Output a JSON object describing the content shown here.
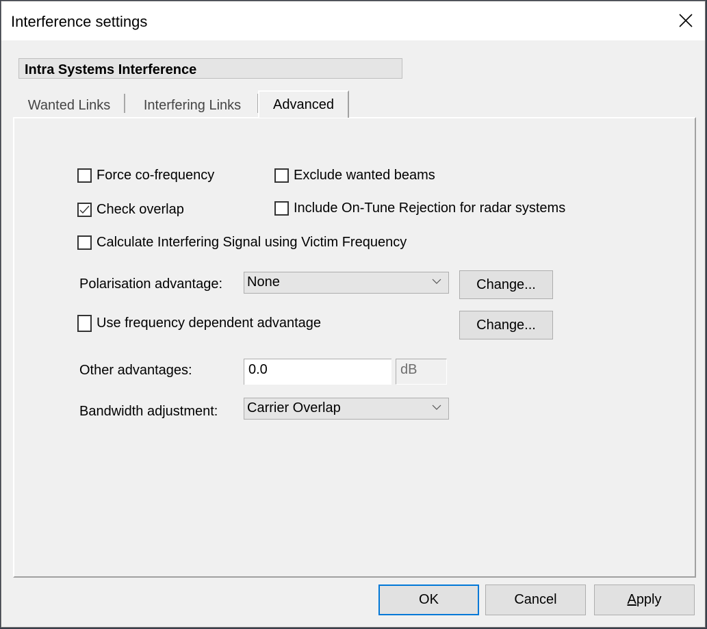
{
  "window": {
    "title": "Interference settings",
    "close_icon": "close-icon"
  },
  "group_header": "Intra Systems Interference",
  "tabs": [
    {
      "label": "Wanted Links",
      "active": false
    },
    {
      "label": "Interfering Links",
      "active": false
    },
    {
      "label": "Advanced",
      "active": true
    }
  ],
  "advanced": {
    "checkboxes": {
      "force_co_frequency": {
        "label": "Force co-frequency",
        "checked": false
      },
      "exclude_wanted_beams": {
        "label": "Exclude wanted beams",
        "checked": false
      },
      "check_overlap": {
        "label": "Check overlap",
        "checked": true
      },
      "include_on_tune_rejection": {
        "label": "Include On-Tune Rejection for radar systems",
        "checked": false
      },
      "calc_using_victim_freq": {
        "label": "Calculate Interfering Signal using Victim Frequency",
        "checked": false
      },
      "use_freq_dependent_adv": {
        "label": "Use frequency dependent advantage",
        "checked": false
      }
    },
    "polarisation": {
      "label": "Polarisation advantage:",
      "selected": "None",
      "change_label": "Change..."
    },
    "freq_dependent_change_label": "Change...",
    "other_advantages": {
      "label": "Other advantages:",
      "value": "0.0",
      "unit": "dB"
    },
    "bandwidth": {
      "label": "Bandwidth adjustment:",
      "selected": "Carrier Overlap"
    }
  },
  "footer": {
    "ok_label": "OK",
    "cancel_label": "Cancel",
    "apply_label_accel": "A",
    "apply_label_rest": "pply"
  },
  "colors": {
    "focus_border": "#0078d7",
    "dialog_bg": "#f0f0f0"
  }
}
